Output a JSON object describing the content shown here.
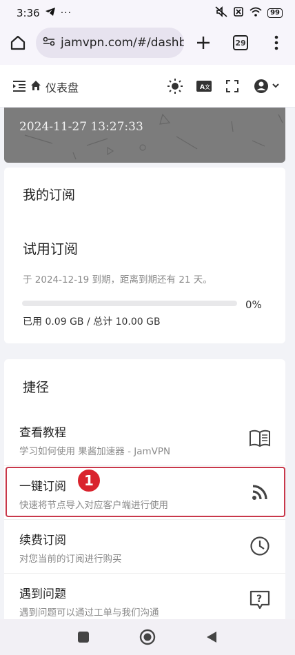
{
  "status_bar": {
    "time": "3:36",
    "battery": "99"
  },
  "browser": {
    "url": "jamvpn.com/#/dashbo",
    "tab_count": "29"
  },
  "app_header": {
    "title": "仪表盘"
  },
  "banner": {
    "date": "2024-11-27 13:27:33"
  },
  "subscription": {
    "section_title": "我的订阅",
    "plan_name": "试用订阅",
    "expiry_text": "于 2024-12-19 到期，距离到期还有 21 天。",
    "progress_percent": "0%",
    "progress_value": 0,
    "usage_text": "已用 0.09 GB / 总计 10.00 GB"
  },
  "shortcuts": {
    "section_title": "捷径",
    "items": [
      {
        "title": "查看教程",
        "desc": "学习如何使用 果酱加速器 - JamVPN",
        "icon": "book-icon"
      },
      {
        "title": "一键订阅",
        "desc": "快速将节点导入对应客户端进行使用",
        "icon": "rss-icon"
      },
      {
        "title": "续费订阅",
        "desc": "对您当前的订阅进行购买",
        "icon": "clock-icon"
      },
      {
        "title": "遇到问题",
        "desc": "遇到问题可以通过工单与我们沟通",
        "icon": "help-chat-icon"
      }
    ]
  },
  "annotation": {
    "badge_number": "1"
  },
  "colors": {
    "accent": "#1e88e5",
    "highlight_border": "#c8374a",
    "badge": "#d9232d"
  }
}
